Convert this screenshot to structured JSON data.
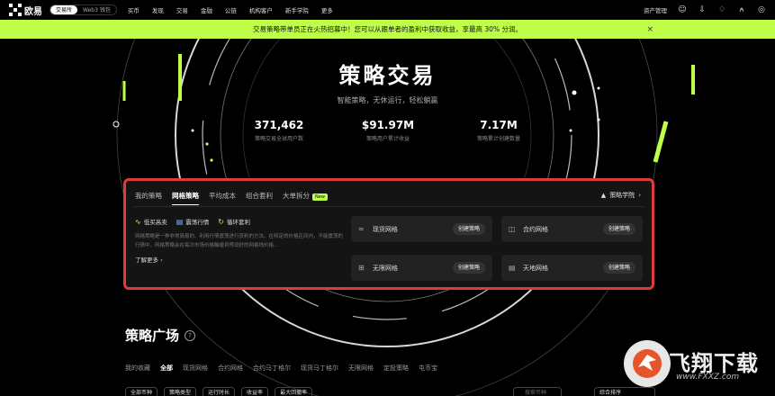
{
  "nav": {
    "brand": "欧易",
    "segments": [
      "交易所",
      "Web3 钱包"
    ],
    "items": [
      "买币",
      "发现",
      "交易",
      "金融",
      "公链",
      "机构客户",
      "新手学院",
      "更多"
    ],
    "right": {
      "asset_label": "资产管理"
    }
  },
  "banner": {
    "text": "交易策略带单员正在火热招募中！您可以从跟单者的盈利中获取收益，享最高 30% 分润。",
    "close": "×"
  },
  "hero": {
    "title": "策略交易",
    "subtitle": "智能策略，无休运行，轻松躺赢",
    "stats": [
      {
        "value": "371,462",
        "label": "策略交易全球用户数"
      },
      {
        "value": "$91.97M",
        "label": "策略用户累计收益"
      },
      {
        "value": "7.17M",
        "label": "策略累计创建数量"
      }
    ]
  },
  "panel": {
    "tabs": [
      "我的策略",
      "网格策略",
      "平均成本",
      "组合套利",
      "大单拆分"
    ],
    "new_badge": "New",
    "academy": "策略学院",
    "features": [
      "低买高卖",
      "震荡行情",
      "循环套利"
    ],
    "description": "网格策略是一种非常简易的、利用行情震荡进行获利的方法。在特定的价格区间内，不能震荡的行情中，网格策略会在每次市场价格触碰到预设好的网格线价格...",
    "more": "了解更多",
    "cards": [
      {
        "name": "现货网格",
        "button": "创建策略",
        "icon": "chart-icon"
      },
      {
        "name": "合约网格",
        "button": "创建策略",
        "icon": "contract-icon"
      },
      {
        "name": "无限网格",
        "button": "创建策略",
        "icon": "grid-icon"
      },
      {
        "name": "天地网格",
        "button": "创建策略",
        "icon": "sky-ground-icon"
      }
    ]
  },
  "plaza": {
    "title": "策略广场",
    "tabs": [
      "我的收藏",
      "全部",
      "现货网格",
      "合约网格",
      "合约马丁格尔",
      "现货马丁格尔",
      "无限网格",
      "定投策略",
      "屯币宝"
    ],
    "filters": [
      "全部币种",
      "策略类型",
      "运行时长",
      "收益率",
      "最大回撤率"
    ],
    "search_placeholder": "搜索币种",
    "sort": "综合排序"
  },
  "watermark": {
    "text": "飞翔下载",
    "sub": "www.FXXZ.com"
  },
  "colors": {
    "accent": "#bfff4a",
    "highlight_border": "#e03a3a",
    "background": "#000000"
  }
}
